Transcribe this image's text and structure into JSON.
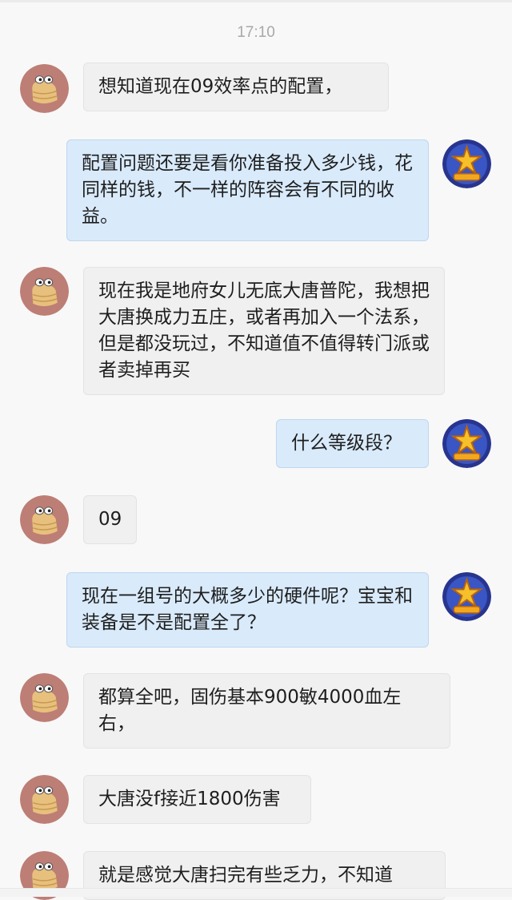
{
  "timestamp": "17:10",
  "colors": {
    "background": "#f8f8f8",
    "incoming_bubble": "#f0f0f0",
    "outgoing_bubble": "#d9eafb",
    "timestamp_text": "#a8a8a8"
  },
  "avatars": {
    "other": "cartoon-character-avatar",
    "self": "dream-logo-avatar"
  },
  "messages": [
    {
      "sender": "other",
      "text": "想知道现在09效率点的配置，"
    },
    {
      "sender": "self",
      "text": "配置问题还要是看你准备投入多少钱，花同样的钱，不一样的阵容会有不同的收益。"
    },
    {
      "sender": "other",
      "text": "现在我是地府女儿无底大唐普陀，我想把大唐换成力五庄，或者再加入一个法系，但是都没玩过，不知道值不值得转门派或者卖掉再买"
    },
    {
      "sender": "self",
      "text": "什么等级段？"
    },
    {
      "sender": "other",
      "text": "09"
    },
    {
      "sender": "self",
      "text": "现在一组号的大概多少的硬件呢？宝宝和装备是不是配置全了？"
    },
    {
      "sender": "other",
      "text": "都算全吧，固伤基本900敏4000血左右，"
    },
    {
      "sender": "other",
      "text": "大唐没f接近1800伤害"
    },
    {
      "sender": "other",
      "text": "就是感觉大唐扫完有些乏力，不知道"
    }
  ]
}
